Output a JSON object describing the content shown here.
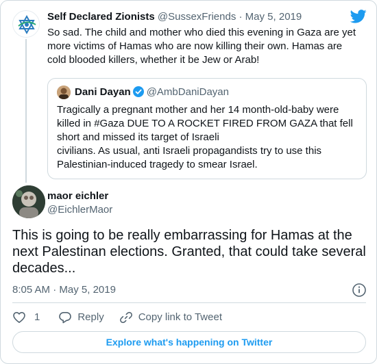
{
  "brand": {
    "accent": "#1d9bf0",
    "text": "#0f1419",
    "muted": "#536471",
    "border": "#cfd9de"
  },
  "parent_tweet": {
    "author_name": "Self Declared Zionists",
    "handle": "@SussexFriends",
    "separator": "·",
    "date": "May 5, 2019",
    "text": "So sad. The child and mother who died this evening in Gaza are yet\nmore victims of Hamas who are now killing their own.  Hamas are\ncold blooded killers, whether it be Jew or Arab!",
    "avatar_icon": "star-of-david-logo-icon"
  },
  "quoted_tweet": {
    "author_name": "Dani Dayan",
    "verified_icon": "verified-badge-icon",
    "handle": "@AmbDaniDayan",
    "text": "Tragically a pregnant mother and her 14 month-old-baby were\nkilled in #Gaza DUE TO A ROCKET FIRED FROM GAZA that fell\nshort and missed its target of Israeli\ncivilians. As usual, anti Israeli propagandists try to use this\nPalestinian-induced tragedy to smear Israel."
  },
  "main_tweet": {
    "author_name": "maor eichler",
    "handle": "@EichlerMaor",
    "text": "This is going to be really embarrassing for Hamas at the next Palestinan elections. Granted, that could take several decades...",
    "time": "8:05 AM",
    "separator": "·",
    "date": "May 5, 2019"
  },
  "actions": {
    "like_count": "1",
    "reply_label": "Reply",
    "copy_link_label": "Copy link to Tweet"
  },
  "footer": {
    "explore_label": "Explore what's happening on Twitter"
  },
  "icons": [
    "twitter-bird-icon",
    "info-icon",
    "heart-icon",
    "reply-bubble-icon",
    "link-icon"
  ]
}
